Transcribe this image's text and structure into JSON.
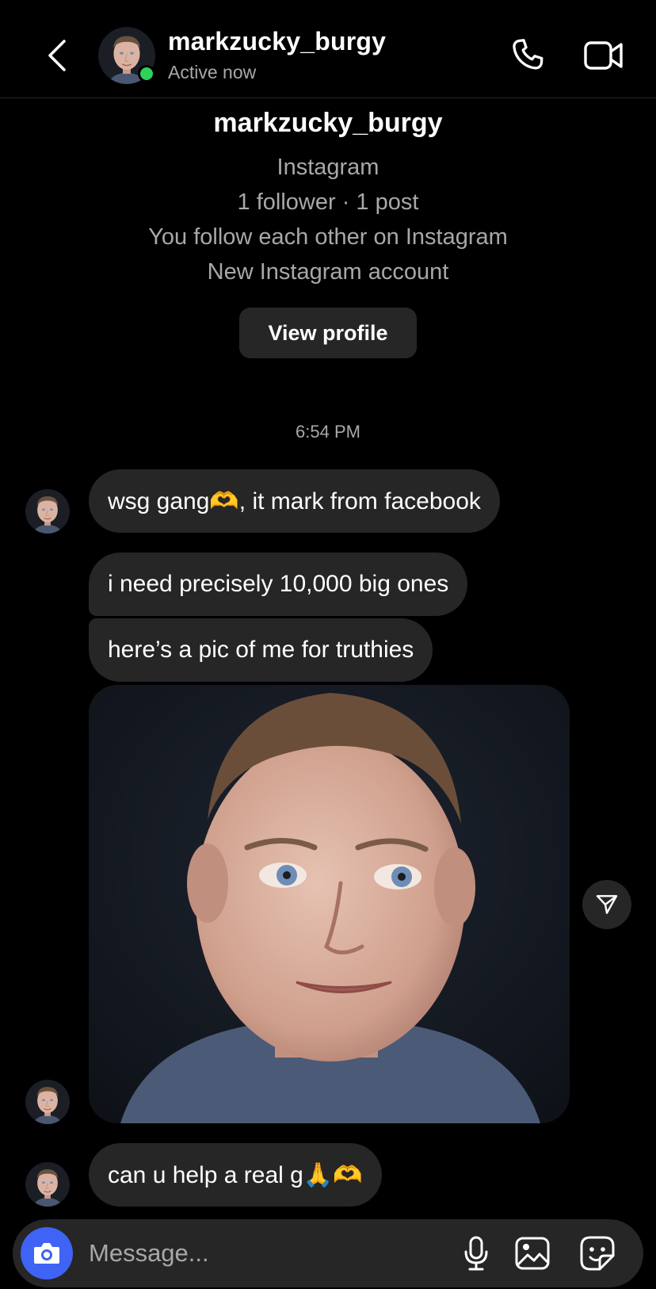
{
  "header": {
    "username": "markzucky_burgy",
    "status": "Active now"
  },
  "profile": {
    "name": "markzucky_burgy",
    "platform": "Instagram",
    "stats": "1 follower · 1 post",
    "relationship": "You follow each other on Instagram",
    "note": "New Instagram account",
    "view_button": "View profile"
  },
  "conversation": {
    "timestamp": "6:54 PM",
    "messages": [
      {
        "text": "wsg gang🫶, it mark from facebook"
      },
      {
        "text": "i need precisely 10,000 big ones"
      },
      {
        "text": "here’s a pic of me for truthies"
      },
      {
        "text": "can u help a real g🙏🫶"
      }
    ]
  },
  "composer": {
    "placeholder": "Message..."
  },
  "icons": {
    "back": "chevron-left-icon",
    "call": "phone-icon",
    "video": "video-camera-icon",
    "camera": "camera-icon",
    "mic": "microphone-icon",
    "gallery": "image-icon",
    "sticker": "sticker-icon",
    "share": "send-icon"
  },
  "colors": {
    "background": "#000000",
    "bubble": "#262626",
    "secondary_text": "#a8a8a8",
    "online": "#2fd158",
    "camera_button": "#3f63f5"
  }
}
